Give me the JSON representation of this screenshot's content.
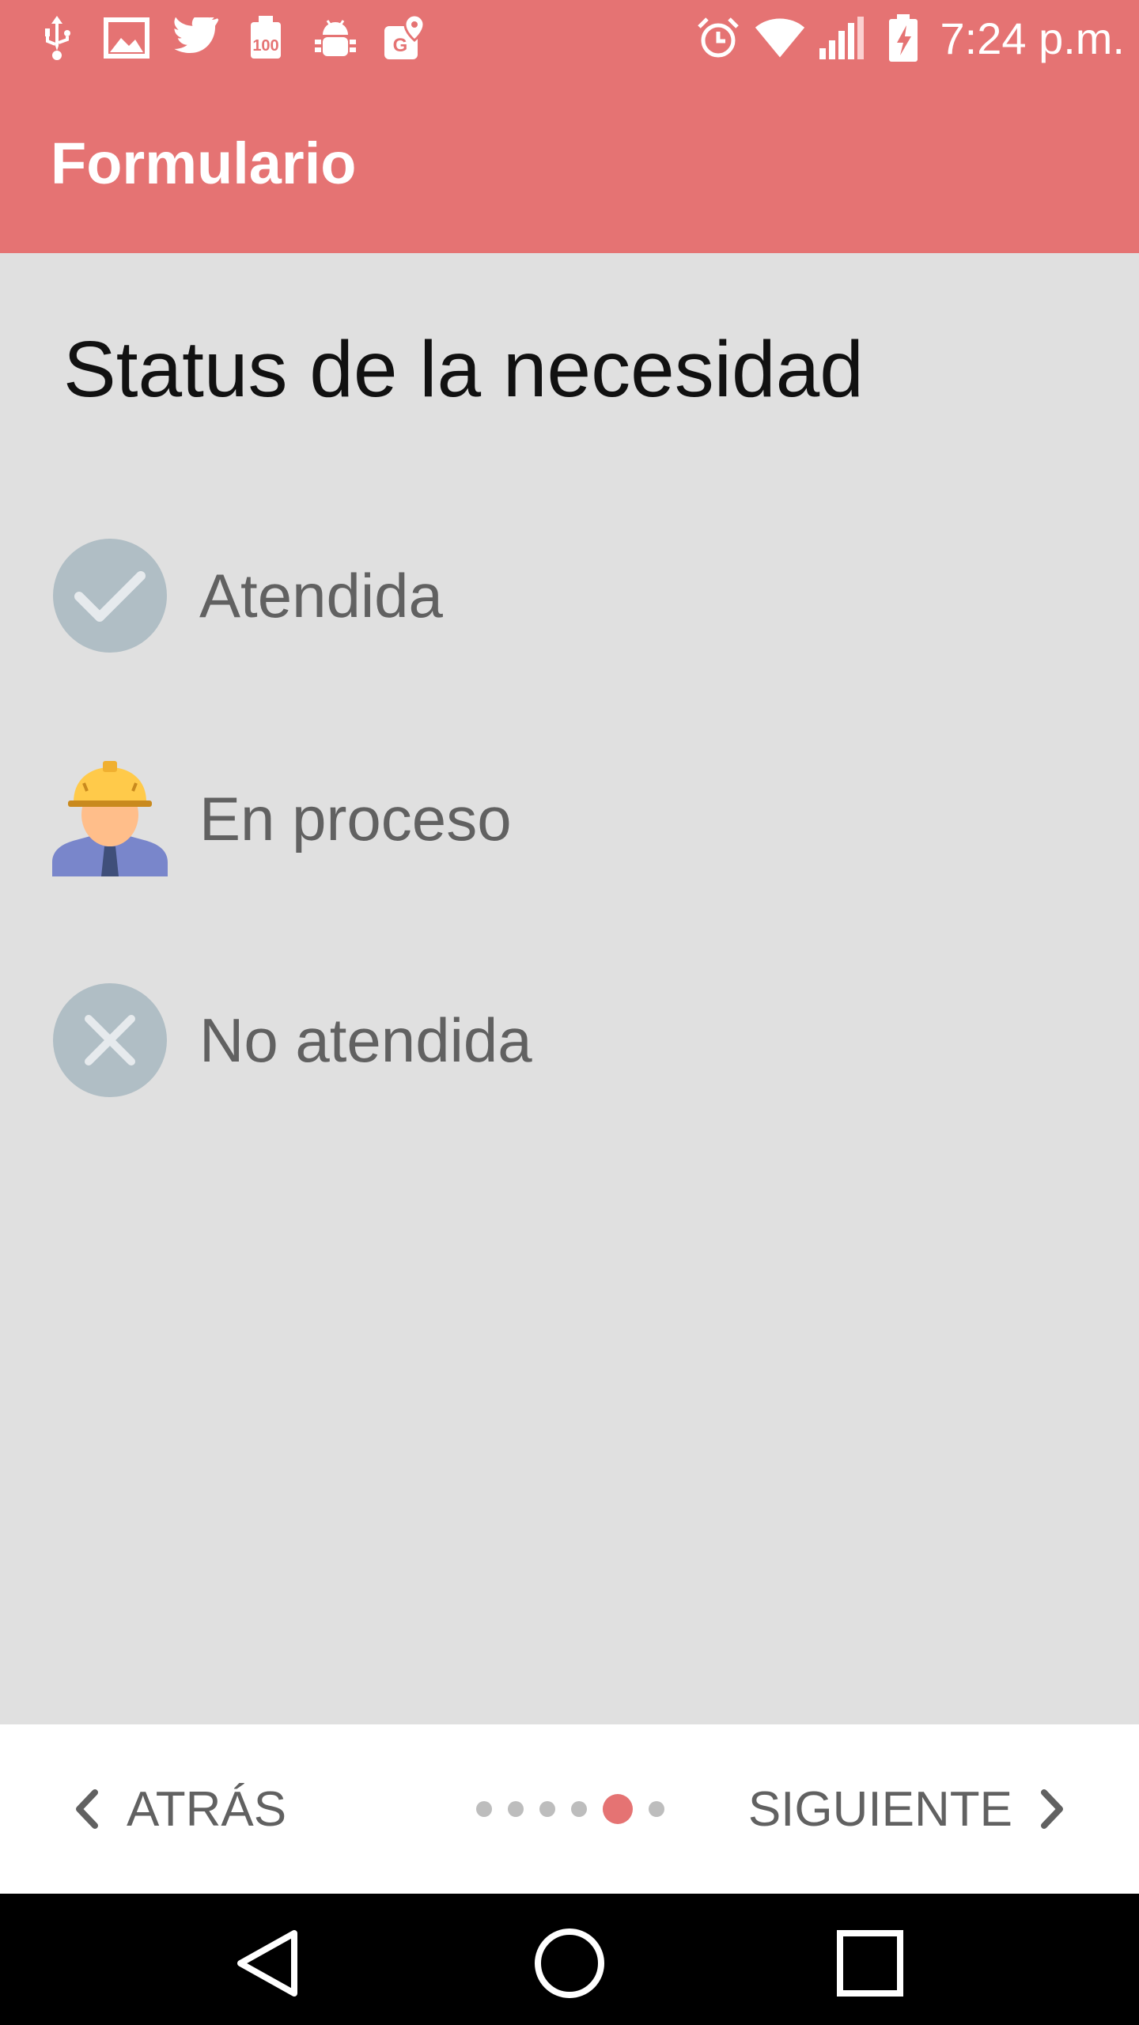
{
  "status_bar": {
    "time": "7:24 p.m.",
    "left_icons": [
      "usb-icon",
      "image-icon",
      "twitter-icon",
      "iso-100-icon",
      "android-debug-icon",
      "map-pin-icon"
    ],
    "right_icons": [
      "alarm-icon",
      "wifi-icon",
      "signal-icon",
      "battery-charging-icon"
    ]
  },
  "app_bar": {
    "title": "Formulario"
  },
  "question": {
    "title": "Status de la necesidad",
    "options": [
      {
        "label": "Atendida",
        "icon": "check-circle-icon"
      },
      {
        "label": "En proceso",
        "icon": "worker-icon"
      },
      {
        "label": "No atendida",
        "icon": "x-circle-icon"
      }
    ]
  },
  "bottom_nav": {
    "back_label": "ATRÁS",
    "next_label": "SIGUIENTE",
    "page_count": 6,
    "current_page": 5
  },
  "colors": {
    "accent": "#e57373",
    "background": "#e0e0e0",
    "icon_circle": "#b0bec5",
    "text_secondary": "#616161"
  }
}
